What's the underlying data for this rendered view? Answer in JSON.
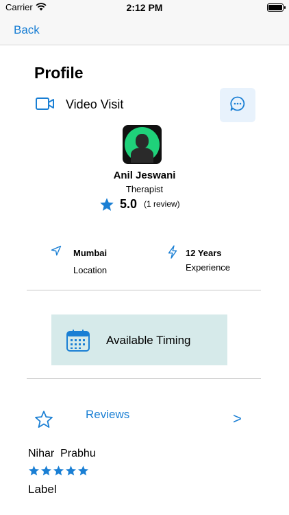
{
  "status_bar": {
    "carrier": "Carrier",
    "time": "2:12 PM"
  },
  "nav": {
    "back_label": "Back"
  },
  "page": {
    "title": "Profile"
  },
  "visit": {
    "type_label": "Video Visit",
    "icon": "video-camera-icon",
    "chat_icon": "chat-bubble-icon"
  },
  "doctor": {
    "name": "Anil Jeswani",
    "role": "Therapist",
    "rating": "5.0",
    "review_count": "(1 review)"
  },
  "info": {
    "location_value": "Mumbai",
    "location_label": "Location",
    "experience_value": "12 Years",
    "experience_label": "Experience"
  },
  "timing": {
    "label": "Available Timing",
    "icon": "calendar-icon"
  },
  "reviews": {
    "title": "Reviews",
    "arrow": ">",
    "items": [
      {
        "reviewer": "Nihar  Prabhu",
        "stars": 5,
        "text": "Label"
      }
    ]
  },
  "colors": {
    "accent": "#1a7fd4",
    "timing_bg": "#d6eaea",
    "chat_bg": "#e8f2fc"
  }
}
